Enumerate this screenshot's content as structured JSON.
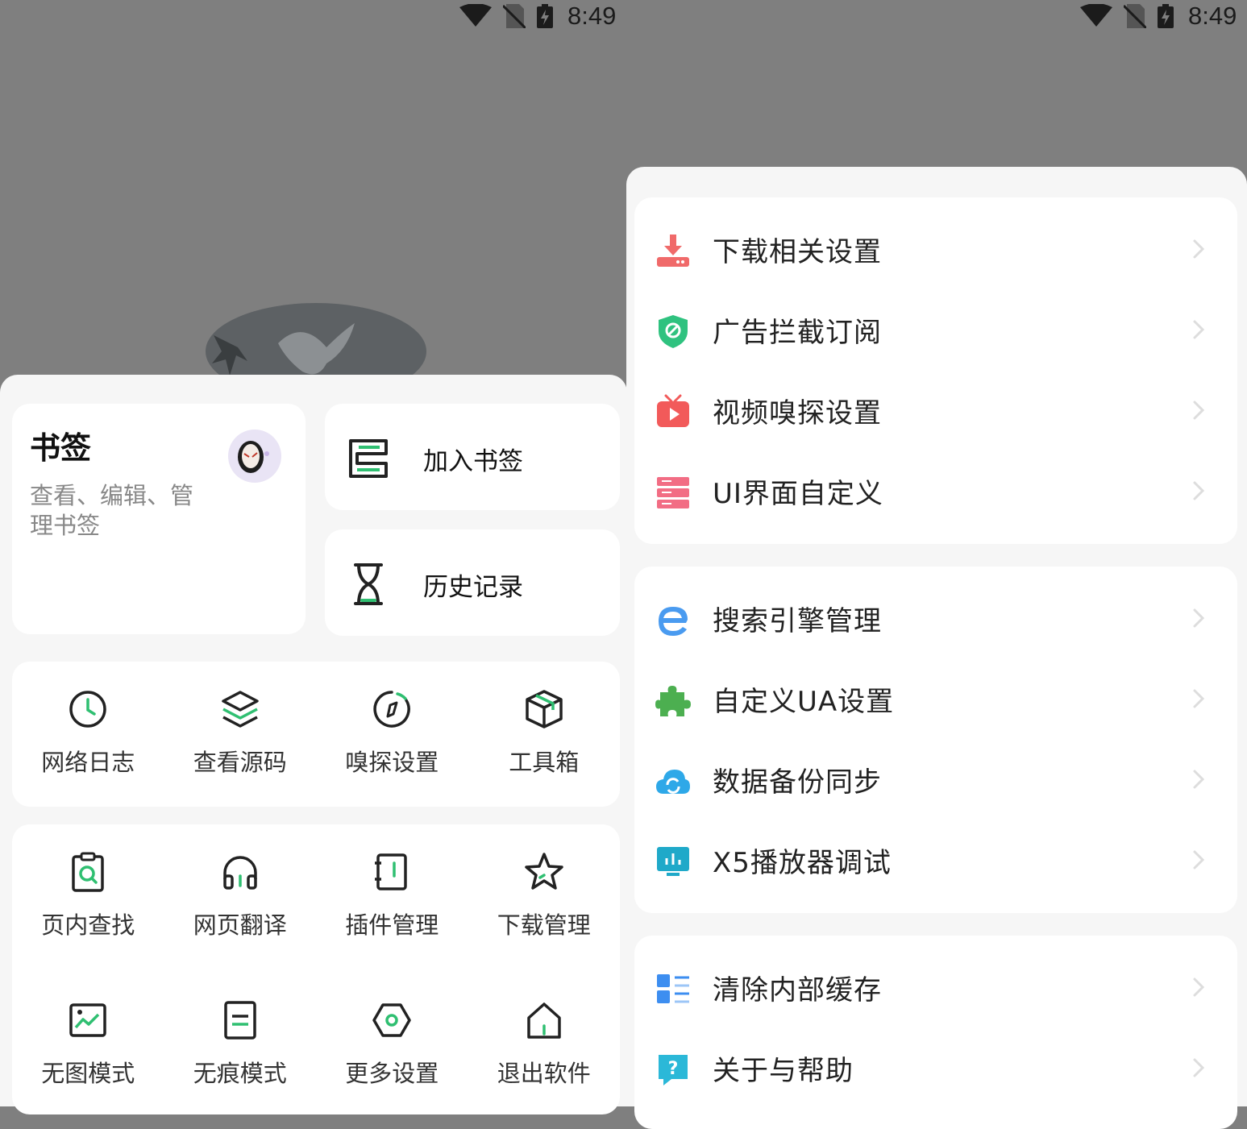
{
  "status_bar": {
    "left_time": "8:49",
    "right_time": "8:49"
  },
  "bookmark": {
    "title": "书签",
    "subtitle": "查看、编辑、管理书签"
  },
  "quick_actions": [
    {
      "label": "加入书签",
      "icon": "bookmark-add-icon"
    },
    {
      "label": "历史记录",
      "icon": "hourglass-icon"
    }
  ],
  "tools_row": [
    {
      "label": "网络日志",
      "icon": "clock-icon"
    },
    {
      "label": "查看源码",
      "icon": "layers-icon"
    },
    {
      "label": "嗅探设置",
      "icon": "compass-icon"
    },
    {
      "label": "工具箱",
      "icon": "box-icon"
    }
  ],
  "tools_row2": [
    {
      "label": "页内查找",
      "icon": "find-in-page-icon"
    },
    {
      "label": "网页翻译",
      "icon": "headphones-icon"
    },
    {
      "label": "插件管理",
      "icon": "plugin-book-icon"
    },
    {
      "label": "下载管理",
      "icon": "star-icon"
    }
  ],
  "tools_row3": [
    {
      "label": "无图模式",
      "icon": "image-icon"
    },
    {
      "label": "无痕模式",
      "icon": "document-icon"
    },
    {
      "label": "更多设置",
      "icon": "hexagon-settings-icon"
    },
    {
      "label": "退出软件",
      "icon": "home-exit-icon"
    }
  ],
  "settings_group1": [
    {
      "label": "下载相关设置",
      "icon": "download-icon",
      "color": "#f06a6a"
    },
    {
      "label": "广告拦截订阅",
      "icon": "shield-block-icon",
      "color": "#2fc27f"
    },
    {
      "label": "视频嗅探设置",
      "icon": "tv-play-icon",
      "color": "#f25a5a"
    },
    {
      "label": "UI界面自定义",
      "icon": "server-rack-icon",
      "color": "#f26d84"
    }
  ],
  "settings_group2": [
    {
      "label": "搜索引擎管理",
      "icon": "browser-e-icon",
      "color": "#4a9bf0"
    },
    {
      "label": "自定义UA设置",
      "icon": "puzzle-icon",
      "color": "#4caf50"
    },
    {
      "label": "数据备份同步",
      "icon": "cloud-sync-icon",
      "color": "#2ea8e8"
    },
    {
      "label": "X5播放器调试",
      "icon": "monitor-chart-icon",
      "color": "#1fa9c9"
    }
  ],
  "settings_group3": [
    {
      "label": "清除内部缓存",
      "icon": "list-grid-icon",
      "color": "#3d8ef0"
    },
    {
      "label": "关于与帮助",
      "icon": "help-bubble-icon",
      "color": "#2bb8d8"
    }
  ],
  "colors": {
    "accent": "#2fbf71",
    "panel_bg": "#f6f6f6",
    "dim_bg": "#7f7f7f"
  }
}
